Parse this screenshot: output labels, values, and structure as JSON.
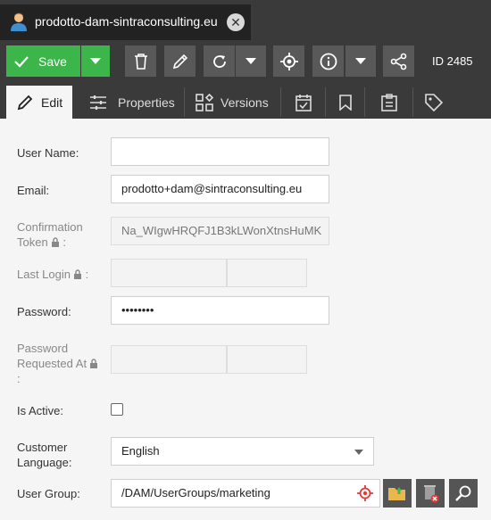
{
  "tab": {
    "title": "prodotto-dam-sintraconsulting.eu",
    "close_symbol": "✕",
    "icon": "user-icon"
  },
  "toolbar": {
    "save_label": "Save",
    "id_label": "ID 2485",
    "icons": [
      "save-check-icon",
      "chevron-down-icon",
      "trash-icon",
      "pencil-icon",
      "reload-icon",
      "chevron-down-icon",
      "target-icon",
      "info-icon",
      "chevron-down-icon",
      "share-icon"
    ]
  },
  "editor_tabs": [
    {
      "label": "Edit",
      "icon": "pencil-icon"
    },
    {
      "label": "Properties",
      "icon": "sliders-icon"
    },
    {
      "label": "Versions",
      "icon": "versions-icon"
    },
    {
      "label": "",
      "icon": "calendar-check-icon"
    },
    {
      "label": "",
      "icon": "bookmark-icon"
    },
    {
      "label": "",
      "icon": "clipboard-icon"
    },
    {
      "label": "",
      "icon": "tag-icon"
    }
  ],
  "form": {
    "username": {
      "label": "User Name:",
      "value": ""
    },
    "email": {
      "label": "Email:",
      "value": "prodotto+dam@sintraconsulting.eu"
    },
    "confirmation_token": {
      "label_line1": "Confirmation",
      "label_line2": "Token",
      "label_suffix": ":",
      "value": "Na_WIgwHRQFJ1B3kLWonXtnsHuMK"
    },
    "last_login": {
      "label": "Last Login",
      "label_suffix": ":"
    },
    "password": {
      "label": "Password:",
      "value": "••••••••"
    },
    "password_requested_at": {
      "label_line1": "Password",
      "label_line2": "Requested At",
      "label_line3": ":"
    },
    "is_active": {
      "label": "Is Active:",
      "checked": false
    },
    "customer_language": {
      "label_line1": "Customer",
      "label_line2": "Language:",
      "value": "English"
    },
    "user_group": {
      "label": "User Group:",
      "value": "/DAM/UserGroups/marketing"
    }
  },
  "colors": {
    "save_green": "#3cb54a",
    "toolbar_dark": "#3a3a3a",
    "button_gray": "#595959",
    "locate_red": "#e53935"
  }
}
